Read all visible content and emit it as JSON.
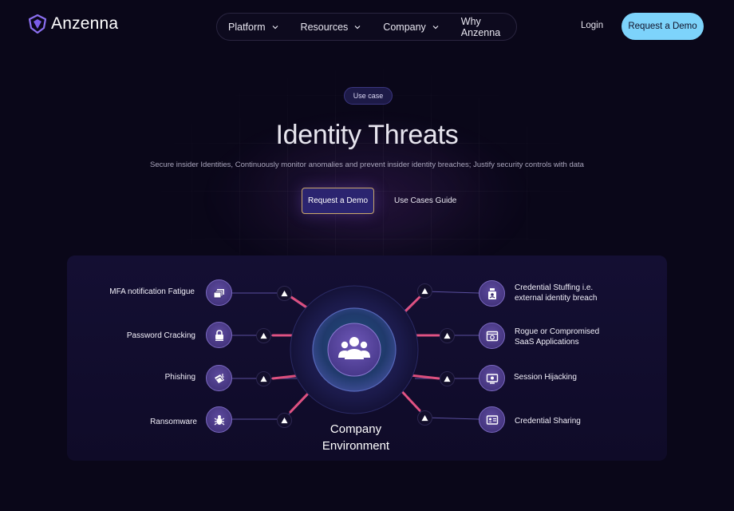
{
  "brand": {
    "name": "Anzenna"
  },
  "nav": {
    "items": [
      {
        "label": "Platform",
        "has_dropdown": true
      },
      {
        "label": "Resources",
        "has_dropdown": true
      },
      {
        "label": "Company",
        "has_dropdown": true
      },
      {
        "label": "Why Anzenna",
        "has_dropdown": false
      }
    ],
    "login": "Login",
    "cta": "Request a Demo"
  },
  "hero": {
    "badge": "Use case",
    "title": "Identity Threats",
    "subtitle": "Secure insider Identities, Continuously monitor anomalies and prevent insider identity breaches; Justify security controls with data",
    "primary_cta": "Request a Demo",
    "secondary_cta": "Use Cases Guide"
  },
  "diagram": {
    "center_label_line1": "Company",
    "center_label_line2": "Environment",
    "center_icon": "users-group-icon",
    "left_threats": [
      {
        "label": "MFA notification Fatigue",
        "icon": "stacked-cards-icon"
      },
      {
        "label": "Password Cracking",
        "icon": "lock-icon"
      },
      {
        "label": "Phishing",
        "icon": "hook-envelope-icon"
      },
      {
        "label": "Ransomware",
        "icon": "bug-icon"
      }
    ],
    "right_threats": [
      {
        "line1": "Credential Stuffing  i.e.",
        "line2": "external identity breach",
        "icon": "id-badge-icon"
      },
      {
        "line1": "Rogue or Compromised",
        "line2": "SaaS Applications",
        "icon": "app-window-icon"
      },
      {
        "line1": "Session Hijacking",
        "line2": "",
        "icon": "monitor-icon"
      },
      {
        "line1": "Credential Sharing",
        "line2": "",
        "icon": "id-card-icon"
      }
    ]
  },
  "colors": {
    "background": "#0a0719",
    "accent_cta": "#7dd3fb",
    "panel": "#140f33",
    "threat_glow": "#ff5a8a"
  }
}
